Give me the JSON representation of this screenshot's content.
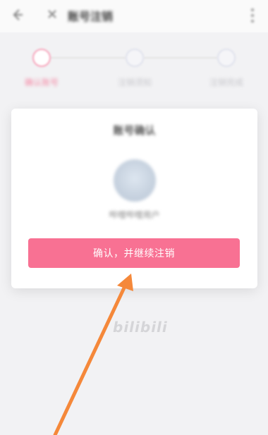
{
  "header": {
    "title": "账号注销",
    "icons": [
      "back-icon",
      "close-icon",
      "more-icon"
    ]
  },
  "steps": [
    {
      "label": "确认账号",
      "active": true
    },
    {
      "label": "注销须知",
      "active": false
    },
    {
      "label": "注销完成",
      "active": false
    }
  ],
  "card": {
    "title": "账号确认",
    "account_name": "哔哩哔哩用户"
  },
  "actions": {
    "confirm_label": "确认，并继续注销"
  },
  "watermark": {
    "text": "bilibili"
  },
  "colors": {
    "accent_pink": "#f87193",
    "annotation_arrow": "#f5883a"
  }
}
